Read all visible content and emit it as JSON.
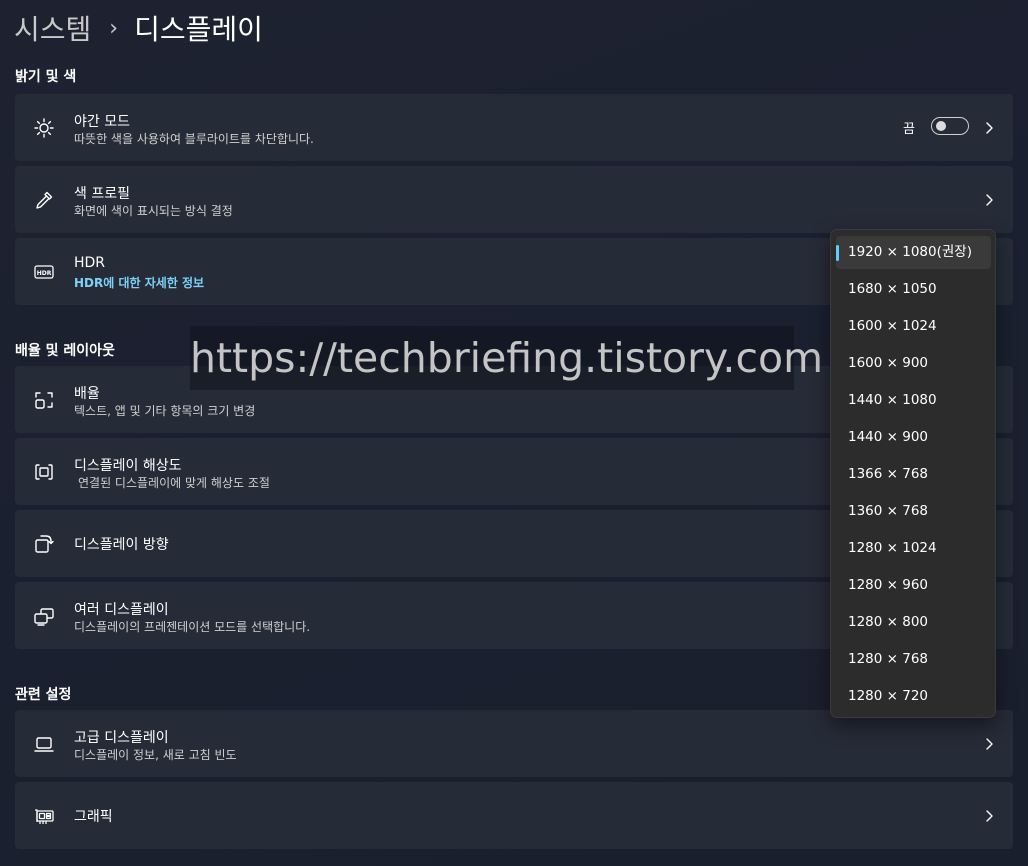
{
  "breadcrumb": {
    "parent": "시스템",
    "separator": "›",
    "current": "디스플레이"
  },
  "sections": {
    "brightness_color": "밝기 및 색",
    "scale_layout": "배율 및 레이아웃",
    "related": "관련 설정"
  },
  "cards": {
    "night_light": {
      "title": "야간 모드",
      "subtitle": "따뜻한 색을 사용하여 블루라이트를 차단합니다.",
      "toggle_state": "끔",
      "icon": "brightness-icon"
    },
    "color_profile": {
      "title": "색 프로필",
      "subtitle": "화면에 색이 표시되는 방식 결정",
      "icon": "eyedropper-icon"
    },
    "hdr": {
      "title": "HDR",
      "subtitle": "HDR에 대한 자세한 정보",
      "icon": "hdr-icon"
    },
    "scale": {
      "title": "배율",
      "subtitle": "텍스트, 앱 및 기타 항목의 크기 변경",
      "icon": "scale-icon"
    },
    "resolution": {
      "title": "디스플레이 해상도",
      "subtitle": "연결된 디스플레이에 맞게 해상도 조절",
      "icon": "resolution-icon"
    },
    "orientation": {
      "title": "디스플레이 방향",
      "icon": "orientation-icon"
    },
    "multiple": {
      "title": "여러 디스플레이",
      "subtitle": "디스플레이의 프레젠테이션 모드를 선택합니다.",
      "icon": "multiple-displays-icon"
    },
    "advanced": {
      "title": "고급 디스플레이",
      "subtitle": "디스플레이 정보, 새로 고침 빈도",
      "icon": "monitor-icon"
    },
    "graphics": {
      "title": "그래픽",
      "icon": "graphics-card-icon"
    }
  },
  "watermark": "https://techbriefing.tistory.com",
  "resolution_dropdown": {
    "selected_index": 0,
    "options": [
      "1920 × 1080(권장)",
      "1680 × 1050",
      "1600 × 1024",
      "1600 × 900",
      "1440 × 1080",
      "1440 × 900",
      "1366 × 768",
      "1360 × 768",
      "1280 × 1024",
      "1280 × 960",
      "1280 × 800",
      "1280 × 768",
      "1280 × 720"
    ]
  },
  "colors": {
    "accent": "#60cdff",
    "link": "#7fd0f5",
    "card_bg": "#262b38",
    "dropdown_bg": "#2c2c2c"
  }
}
